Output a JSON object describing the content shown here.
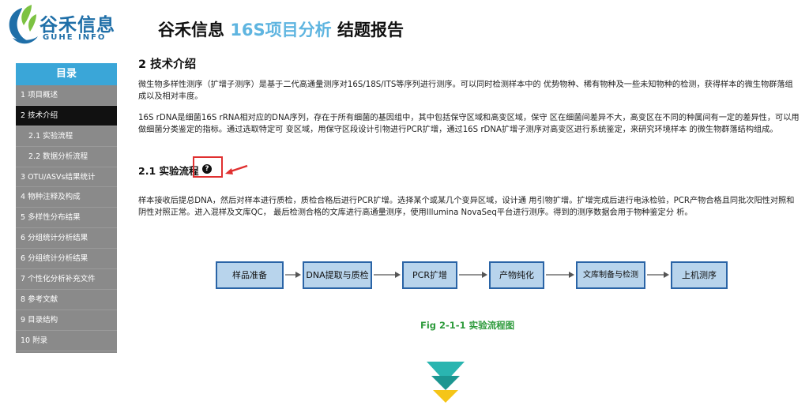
{
  "brand": {
    "name_cn": "谷禾信息",
    "name_en": "GUHE INFO",
    "colors": {
      "primary": "#1f6fa8",
      "leaf_green": "#7cc242"
    }
  },
  "report_title": {
    "prefix": "谷禾信息",
    "highlight": "16S项目分析",
    "suffix": "结题报告"
  },
  "sidebar": {
    "header": "目录",
    "items": [
      {
        "label": "1 项目概述",
        "level": 1,
        "active": false
      },
      {
        "label": "2 技术介绍",
        "level": 1,
        "active": true
      },
      {
        "label": "2.1 实验流程",
        "level": 2,
        "active": false
      },
      {
        "label": "2.2 数据分析流程",
        "level": 2,
        "active": false
      },
      {
        "label": "3 OTU/ASVs结果统计",
        "level": 1,
        "active": false
      },
      {
        "label": "4 物种注释及构成",
        "level": 1,
        "active": false
      },
      {
        "label": "5 多样性分布结果",
        "level": 1,
        "active": false
      },
      {
        "label": "6 分组统计分析结果",
        "level": 1,
        "active": false
      },
      {
        "label": "6 分组统计分析结果",
        "level": 1,
        "active": false
      },
      {
        "label": "7 个性化分析补充文件",
        "level": 1,
        "active": false
      },
      {
        "label": "8 参考文献",
        "level": 1,
        "active": false
      },
      {
        "label": "9 目录结构",
        "level": 1,
        "active": false
      },
      {
        "label": "10 附录",
        "level": 1,
        "active": false
      }
    ]
  },
  "section": {
    "heading": "2 技术介绍",
    "para1": "微生物多样性测序（扩增子测序）是基于二代高通量测序对16S/18S/ITS等序列进行测序。可以同时检测样本中的 优势物种、稀有物种及一些未知物种的检测，获得样本的微生物群落组成以及相对丰度。",
    "para2": "16S rDNA是细菌16S rRNA相对应的DNA序列，存在于所有细菌的基因组中，其中包括保守区域和高变区域，保守 区在细菌间差异不大，高变区在不同的种属间有一定的差异性，可以用做细菌分类鉴定的指标。通过选取特定可 变区域，用保守区段设计引物进行PCR扩增，通过16S rDNA扩增子测序对高变区进行系统鉴定，来研究环境样本 的微生物群落结构组成。",
    "subheading": "2.1 实验流程",
    "help_icon": "question-circle-icon",
    "para3": "样本接收后提总DNA，然后对样本进行质检，质检合格后进行PCR扩增。选择某个或某几个变异区域，设计通 用引物扩增。扩增完成后进行电泳检验，PCR产物合格且同批次阳性对照和阴性对照正常。进入混样及文库QC， 最后检测合格的文库进行高通量测序，使用Illumina NovaSeq平台进行测序。得到的测序数据会用于物种鉴定分 析。"
  },
  "flow": {
    "steps": [
      "样品准备",
      "DNA提取与质检",
      "PCR扩增",
      "产物纯化",
      "文库制备与检测",
      "上机测序"
    ],
    "caption": "Fig 2-1-1 实验流程图",
    "colors": {
      "box_fill": "#b8d4ec",
      "box_border": "#2a64a6",
      "caption": "#2e9b3c"
    }
  },
  "scroll_indicator": {
    "icon": "double-chevron-down-icon",
    "colors": [
      "#2ab5b0",
      "#f5c518"
    ]
  }
}
